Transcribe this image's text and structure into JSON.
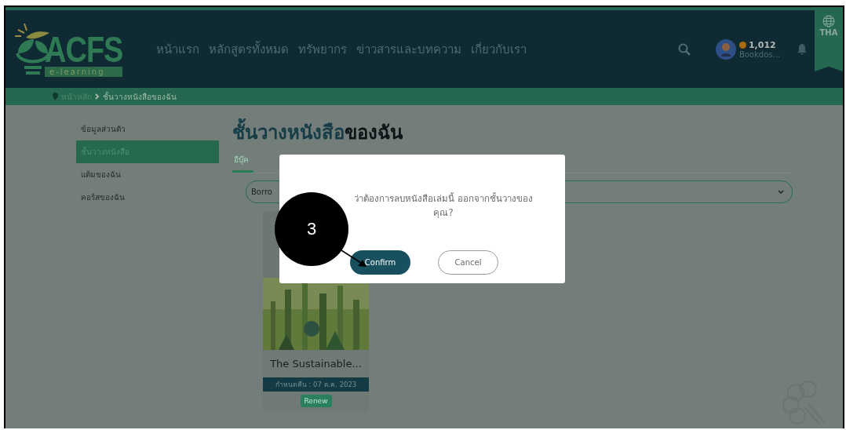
{
  "header": {
    "logo": {
      "title": "ACFS",
      "subtitle": "e-learning"
    },
    "nav": [
      "หน้าแรก",
      "หลักสูตรทั้งหมด",
      "ทรัพยากร",
      "ข่าวสารและบทความ",
      "เกี่ยวกับเรา"
    ],
    "user": {
      "coins": "1,012",
      "name": "Bookdos..."
    },
    "language": "THA"
  },
  "breadcrumb": [
    {
      "label": "หน้าหลัก",
      "current": false
    },
    {
      "label": "ชั้นวางหนังสือของฉัน",
      "current": true
    }
  ],
  "sidebar": {
    "items": [
      {
        "label": "ข้อมูลส่วนตัว",
        "selected": false
      },
      {
        "label": "ชั้นวางหนังสือ",
        "selected": true
      },
      {
        "label": "แต้มของฉัน",
        "selected": false
      },
      {
        "label": "คอร์สของฉัน",
        "selected": false
      }
    ]
  },
  "page_title": "ชั้นวางหนังสือ**ของฉัน**",
  "tabs": [
    {
      "label": "อีบุ๊ค",
      "selected": true
    }
  ],
  "filter": {
    "value": "Borro"
  },
  "books": [
    {
      "title": "The Sustainable...",
      "due": "กำหนดคืน : 07 ต.ค. 2023",
      "action": "Renew"
    }
  ],
  "dialog": {
    "message": "ว่าต้องการลบหนังสือเล่มนี้ ออกจากชั้นวางของ\nคุณ?",
    "confirm": "Confirm",
    "cancel": "Cancel"
  },
  "annotation": {
    "number": "3"
  }
}
